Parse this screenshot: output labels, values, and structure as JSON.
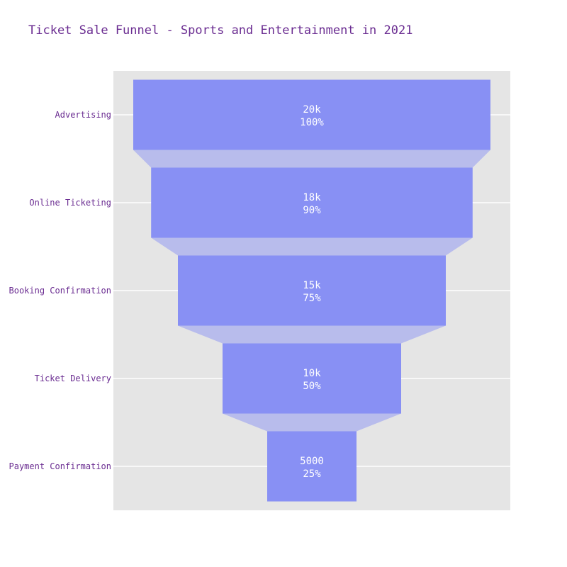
{
  "chart_data": {
    "type": "funnel",
    "title": "Ticket Sale Funnel - Sports and Entertainment in 2021",
    "stages": [
      "Advertising",
      "Online Ticketing",
      "Booking Confirmation",
      "Ticket Delivery",
      "Payment Confirmation"
    ],
    "values": [
      20000,
      18000,
      15000,
      10000,
      5000
    ],
    "value_labels": [
      "20k",
      "18k",
      "15k",
      "10k",
      "5000"
    ],
    "percent_labels": [
      "100%",
      "90%",
      "75%",
      "50%",
      "25%"
    ],
    "grid": true
  },
  "colors": {
    "title": "#6a2c91",
    "tick_label": "#6a2c91",
    "plot_background": "#e5e5e5",
    "grid": "#ffffff",
    "bar": "#8890f4",
    "connector": "#b8bcec",
    "bar_text": "#ffffff"
  }
}
